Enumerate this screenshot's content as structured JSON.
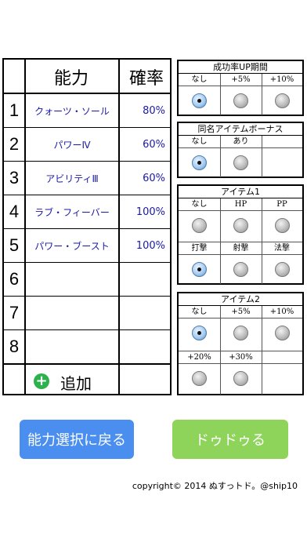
{
  "table": {
    "header": {
      "ability": "能力",
      "probability": "確率"
    },
    "rows": [
      {
        "num": "1",
        "ability": "クォーツ・ソール",
        "prob": "80%"
      },
      {
        "num": "2",
        "ability": "パワーⅣ",
        "prob": "60%"
      },
      {
        "num": "3",
        "ability": "アビリティⅢ",
        "prob": "60%"
      },
      {
        "num": "4",
        "ability": "ラブ・フィーバー",
        "prob": "100%"
      },
      {
        "num": "5",
        "ability": "パワー・ブースト",
        "prob": "100%"
      },
      {
        "num": "6",
        "ability": "",
        "prob": ""
      },
      {
        "num": "7",
        "ability": "",
        "prob": ""
      },
      {
        "num": "8",
        "ability": "",
        "prob": ""
      }
    ],
    "add_label": "追加",
    "add_icon": "plus-circle-icon"
  },
  "panels": {
    "success": {
      "title": "成功率UP期間",
      "options": [
        "なし",
        "+5%",
        "+10%"
      ],
      "selected": "なし"
    },
    "same_name": {
      "title": "同名アイテムボーナス",
      "options": [
        "なし",
        "あり"
      ],
      "selected": "なし"
    },
    "item1": {
      "title": "アイテム1",
      "options": [
        "なし",
        "HP",
        "PP",
        "打撃",
        "射撃",
        "法撃"
      ],
      "selected": "打撃"
    },
    "item2": {
      "title": "アイテム2",
      "options": [
        "なし",
        "+5%",
        "+10%",
        "+20%",
        "+30%"
      ],
      "selected": "なし"
    }
  },
  "buttons": {
    "back": "能力選択に戻る",
    "go": "ドゥドゥる"
  },
  "copyright": "copyright© 2014 ぬすっトド。@ship10",
  "colors": {
    "back": "#4a8ef0",
    "go": "#8fd45a",
    "value_text": "#1a1aa8",
    "add_icon": "#2bb24c"
  }
}
